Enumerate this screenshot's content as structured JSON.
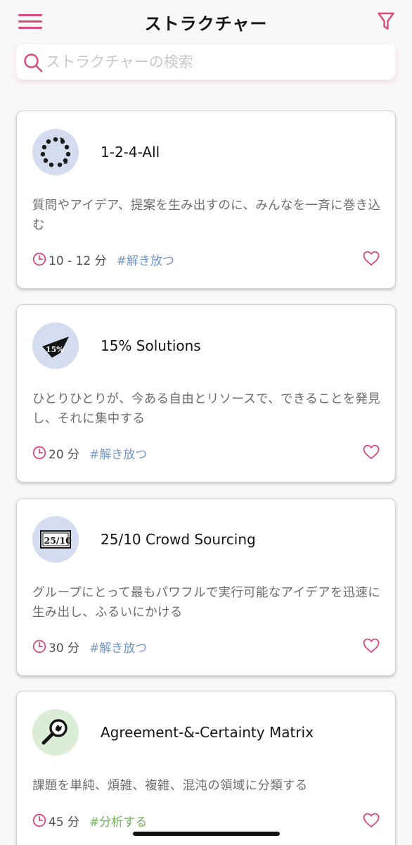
{
  "header": {
    "title": "ストラクチャー",
    "menu_icon": "hamburger-menu-icon",
    "filter_icon": "filter-funnel-icon"
  },
  "search": {
    "placeholder": "ストラクチャーの検索",
    "value": "",
    "icon": "search-icon"
  },
  "cards": [
    {
      "icon": "circle-of-people-icon",
      "icon_bg": "#d4dcef",
      "title": "1-2-4-All",
      "description": "質問やアイデア、提案を生み出すのに、みんなを一斉に巻き込む",
      "duration": "10 - 12 分",
      "tag": "#解き放つ",
      "tag_color": "#7496c9"
    },
    {
      "icon": "15-percent-pennant-icon",
      "icon_bg": "#d4dcef",
      "title": "15% Solutions",
      "description": "ひとりひとりが、今ある自由とリソースで、できることを発見し、それに集中する",
      "duration": "20 分",
      "tag": "#解き放つ",
      "tag_color": "#7496c9"
    },
    {
      "icon": "25-10-scorecard-icon",
      "icon_bg": "#d4dcef",
      "title": "25/10 Crowd Sourcing",
      "description": "グループにとって最もパワフルで実行可能なアイデアを迅速に生み出し、ふるいにかける",
      "duration": "30 分",
      "tag": "#解き放つ",
      "tag_color": "#7496c9"
    },
    {
      "icon": "magnifier-matrix-icon",
      "icon_bg": "#dcedd7",
      "title": "Agreement-&-Certainty Matrix",
      "description": "課題を単純、煩雑、複雑、混沌の領域に分類する",
      "duration": "45 分",
      "tag": "#分析する",
      "tag_color": "#73b35c"
    }
  ],
  "colors": {
    "accent": "#dc4a79",
    "background": "#f9f8f9",
    "card": "#ffffff"
  }
}
